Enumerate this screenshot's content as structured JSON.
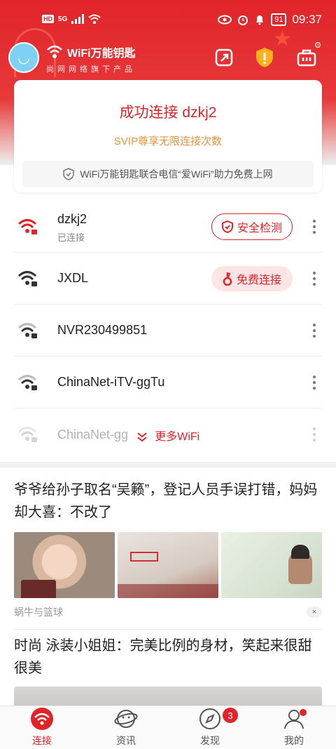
{
  "status_bar": {
    "time": "09:37",
    "battery": "91",
    "hd": "HD",
    "net": "5G"
  },
  "header": {
    "app_name": "WiFi万能钥匙",
    "subtitle": "尚网网络旗下产品"
  },
  "connection": {
    "title": "成功连接 dzkj2",
    "svip": "SVIP尊享无限连接次数",
    "note": "WiFi万能钥匙联合电信“爱WiFi”助力免费上网"
  },
  "wifi_list": [
    {
      "ssid": "dzkj2",
      "state": "已连接",
      "action": "安全检测"
    },
    {
      "ssid": "JXDL",
      "state": "",
      "action": "免费连接"
    },
    {
      "ssid": "NVR230499851",
      "state": "",
      "action": ""
    },
    {
      "ssid": "ChinaNet-iTV-ggTu",
      "state": "",
      "action": ""
    },
    {
      "ssid": "ChinaNet-gg",
      "state": "",
      "action": ""
    }
  ],
  "more_wifi": "更多WiFi",
  "news": [
    {
      "title": "爷爷给孙子取名“吴籁”，登记人员手误打错，妈妈却大喜：不改了",
      "source": "蜗牛与篮球",
      "close": "×"
    },
    {
      "title": "时尚 泳装小姐姐：完美比例的身材，笑起来很甜很美"
    }
  ],
  "tabbar": {
    "tabs": [
      "连接",
      "资讯",
      "发现",
      "我的"
    ],
    "discover_badge": "3"
  },
  "colors": {
    "brand_red": "#e0242a",
    "svip_orange": "#e8943a"
  }
}
